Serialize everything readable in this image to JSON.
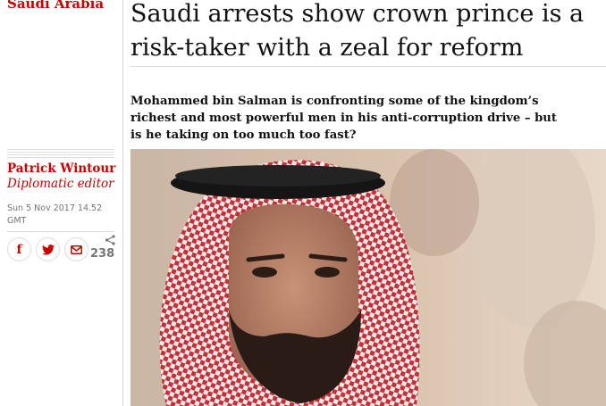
{
  "section": {
    "label": "Saudi Arabia"
  },
  "article": {
    "headline": "Saudi arrests show crown prince is a risk-taker with a zeal for reform",
    "standfirst": "Mohammed bin Salman is confronting some of the kingdom’s richest and most powerful men in his anti-corruption drive – but is he taking on too much too fast?"
  },
  "byline": {
    "name": "Patrick Wintour",
    "role": "Diplomatic editor"
  },
  "dateline": "Sun 5 Nov 2017 14.52 GMT",
  "share": {
    "buttons": [
      {
        "icon": "facebook-icon",
        "glyph": "f"
      },
      {
        "icon": "twitter-icon",
        "glyph": "🐦"
      },
      {
        "icon": "email-icon",
        "glyph": "✉"
      }
    ],
    "count": "238"
  },
  "colors": {
    "accent": "#c70000",
    "text": "#121212",
    "muted": "#767676",
    "divider": "#dcdcdc"
  }
}
